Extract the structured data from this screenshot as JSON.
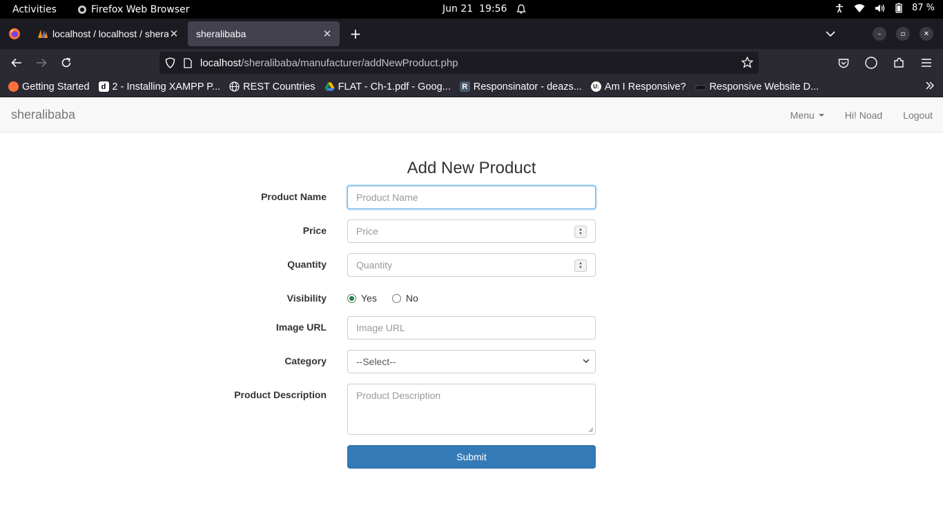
{
  "system_bar": {
    "activities": "Activities",
    "app_name": "Firefox Web Browser",
    "date": "Jun 21",
    "time": "19:56",
    "battery": "87 %"
  },
  "browser": {
    "tabs": [
      {
        "title": "localhost / localhost / sheralibaba",
        "active": false
      },
      {
        "title": "sheralibaba",
        "active": true
      }
    ],
    "url_host": "localhost",
    "url_path": "/sheralibaba/manufacturer/addNewProduct.php",
    "bookmarks": [
      {
        "label": "Getting Started",
        "icon": "firefox-icon"
      },
      {
        "label": "2 - Installing XAMPP P...",
        "icon": "d-icon"
      },
      {
        "label": "REST Countries",
        "icon": "globe-icon"
      },
      {
        "label": "FLAT - Ch-1.pdf - Goog...",
        "icon": "google-drive-icon"
      },
      {
        "label": "Responsinator - deazs...",
        "icon": "r-icon"
      },
      {
        "label": "Am I Responsive?",
        "icon": "ui-icon"
      },
      {
        "label": "Responsive Website D...",
        "icon": "device-icon"
      }
    ]
  },
  "site": {
    "brand": "sheralibaba",
    "menu_label": "Menu",
    "greeting": "Hi! Noad",
    "logout_label": "Logout"
  },
  "form": {
    "title": "Add New Product",
    "product_name": {
      "label": "Product Name",
      "placeholder": "Product Name",
      "value": ""
    },
    "price": {
      "label": "Price",
      "placeholder": "Price",
      "value": ""
    },
    "quantity": {
      "label": "Quantity",
      "placeholder": "Quantity",
      "value": ""
    },
    "visibility": {
      "label": "Visibility",
      "options": [
        "Yes",
        "No"
      ],
      "selected": "Yes"
    },
    "image_url": {
      "label": "Image URL",
      "placeholder": "Image URL",
      "value": ""
    },
    "category": {
      "label": "Category",
      "selected": "--Select--"
    },
    "description": {
      "label": "Product Description",
      "placeholder": "Product Description",
      "value": ""
    },
    "submit_label": "Submit"
  },
  "colors": {
    "submit_bg": "#337ab7",
    "focus_border": "#66afe9",
    "radio_checked": "#2e7d4f"
  }
}
